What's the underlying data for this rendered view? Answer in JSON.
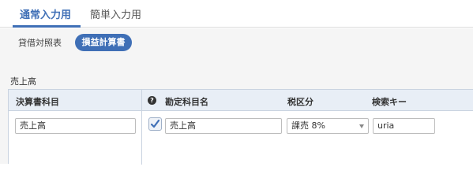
{
  "tabs": [
    {
      "label": "通常入力用",
      "active": true
    },
    {
      "label": "簡単入力用",
      "active": false
    }
  ],
  "subtabs": [
    {
      "label": "貸借対照表",
      "active": false
    },
    {
      "label": "損益計算書",
      "active": true
    }
  ],
  "section_title": "売上高",
  "table": {
    "headers": {
      "settlement_item": "決算書科目",
      "help": "?",
      "account_name": "勘定科目名",
      "tax_category": "税区分",
      "search_key": "検索キー"
    },
    "row": {
      "settlement_item": "売上高",
      "checked": true,
      "account_name": "売上高",
      "tax_category": "課売 8%",
      "search_key": "uria"
    }
  },
  "colors": {
    "accent": "#3f6fb6",
    "header_bg": "#e8eef6",
    "content_bg": "#f5f5f5"
  }
}
